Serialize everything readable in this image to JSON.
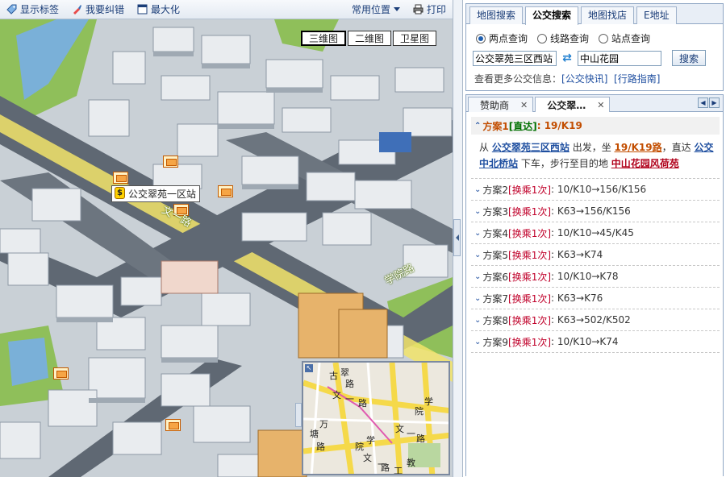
{
  "toolbar": {
    "show_labels": "显示标签",
    "report_error": "我要纠错",
    "maximize": "最大化",
    "common_location": "常用位置",
    "print": "打印"
  },
  "view_switch": {
    "3d": "三维图",
    "2d": "二维图",
    "satellite": "卫星图"
  },
  "map": {
    "station_label": "公交翠苑一区站",
    "station_pin": "$",
    "road_wenyi": "文一路",
    "road_xueyuan": "学院路",
    "overview_labels": [
      "古",
      "翠",
      "路",
      "文",
      "一",
      "路",
      "院",
      "学",
      "万",
      "塘",
      "路",
      "院",
      "学",
      "文",
      "一",
      "路",
      "文",
      "一",
      "路",
      "工",
      "教"
    ]
  },
  "search": {
    "tabs": [
      "地图搜索",
      "公交搜索",
      "地图找店",
      "E地址"
    ],
    "active_tab": 1,
    "radios": [
      "两点查询",
      "线路查询",
      "站点查询"
    ],
    "from_value": "公交翠苑三区西站",
    "to_value": "中山花园",
    "swap_icon": "⇄",
    "button": "搜索",
    "more_prefix": "查看更多公交信息：",
    "link_quick": "[公交快讯]",
    "link_guide": "[行路指南]"
  },
  "results": {
    "tabs": [
      {
        "label": "赞助商",
        "close": "✕"
      },
      {
        "label": "公交翠…",
        "close": "✕"
      }
    ],
    "prev": "◀",
    "next": "▶",
    "plan1": {
      "arrow": "⌃",
      "title": "方案1",
      "tag": "[直达]",
      "route": ": 19/K19",
      "from_text": "从",
      "from_station": "公交翠苑三区西站",
      "mid1": "出发，坐",
      "route_link": "19/K19路",
      "mid2": "，直达",
      "to_station": "公交中北桥站",
      "mid3": "下车，步行至目的地",
      "dest": "中山花园风荷苑"
    },
    "plans": [
      {
        "title": "方案2",
        "tag": "[换乘1次]",
        "route": ": 10/K10→156/K156"
      },
      {
        "title": "方案3",
        "tag": "[换乘1次]",
        "route": ": K63→156/K156"
      },
      {
        "title": "方案4",
        "tag": "[换乘1次]",
        "route": ": 10/K10→45/K45"
      },
      {
        "title": "方案5",
        "tag": "[换乘1次]",
        "route": ": K63→K74"
      },
      {
        "title": "方案6",
        "tag": "[换乘1次]",
        "route": ": 10/K10→K78"
      },
      {
        "title": "方案7",
        "tag": "[换乘1次]",
        "route": ": K63→K76"
      },
      {
        "title": "方案8",
        "tag": "[换乘1次]",
        "route": ": K63→502/K502"
      },
      {
        "title": "方案9",
        "tag": "[换乘1次]",
        "route": ": 10/K10→K74"
      }
    ],
    "collapsed_arrow": "⌄"
  },
  "colors": {
    "accent": "#1f4fa0",
    "route_orange": "#c24d00",
    "transfer_red": "#c0002a",
    "direct_green": "#007000"
  }
}
